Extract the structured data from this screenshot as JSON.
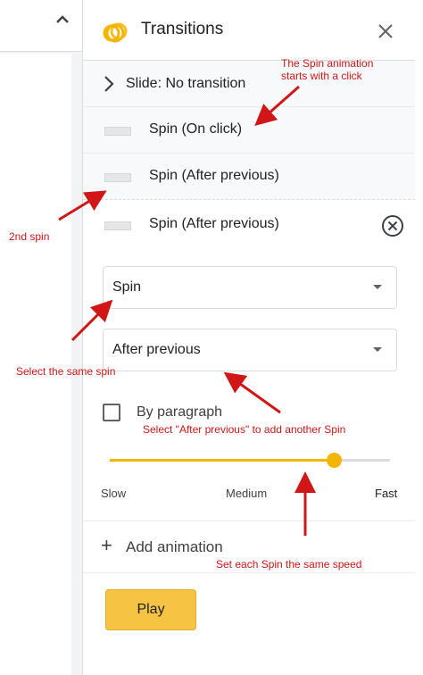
{
  "panel": {
    "title": "Transitions",
    "slide_transition_label": "Slide: No transition",
    "animations": [
      {
        "label": "Spin  (On click)"
      },
      {
        "label": "Spin  (After previous)"
      },
      {
        "label": "Spin  (After previous)"
      }
    ],
    "editor": {
      "effect_select": "Spin",
      "start_select": "After previous",
      "by_paragraph_label": "By paragraph",
      "by_paragraph_checked": false,
      "speed": {
        "slow_label": "Slow",
        "medium_label": "Medium",
        "fast_label": "Fast",
        "level": 0.8
      }
    },
    "add_animation_label": "Add animation",
    "play_label": "Play"
  },
  "annotations": {
    "spin_click_line1": "The Spin animation",
    "spin_click_line2": "starts with a click",
    "second_spin": "2nd spin",
    "select_same_spin": "Select the same spin",
    "after_previous_note": "Select \"After previous\" to add another Spin",
    "same_speed_note": "Set each Spin the same speed"
  },
  "colors": {
    "accent": "#f4b400",
    "annotation": "#d01616",
    "play_button": "#f6c343"
  },
  "icons": [
    "chevron-up-icon",
    "transitions-logo-icon",
    "close-icon",
    "chevron-right-icon",
    "remove-circle-icon",
    "dropdown-caret-icon",
    "plus-icon"
  ]
}
